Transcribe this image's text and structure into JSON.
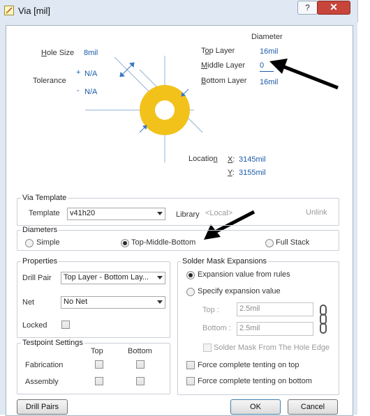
{
  "window": {
    "title": "Via [mil]",
    "help_label": "?",
    "close_label": "✕"
  },
  "diagram": {
    "diameter_heading": "Diameter",
    "hole_size_label": "Hole Size",
    "hole_size_value": "8mil",
    "tolerance_label": "Tolerance",
    "tol_plus_sign": "+",
    "tol_plus_value": "N/A",
    "tol_minus_sign": "-",
    "tol_minus_value": "N/A",
    "top_layer_label": "Top Layer",
    "top_layer_value": "16mil",
    "middle_layer_label": "Middle Layer",
    "middle_layer_value": "0",
    "bottom_layer_label": "Bottom Layer",
    "bottom_layer_value": "16mil",
    "location_label": "Location",
    "x_label": "X:",
    "x_value": "3145mil",
    "y_label": "Y:",
    "y_value": "3155mil",
    "via_color": "#f2c21b"
  },
  "via_template": {
    "group_title": "Via Template",
    "template_label": "Template",
    "template_value": "v41h20",
    "library_label": "Library",
    "library_value": "<Local>",
    "unlink_label": "Unlink"
  },
  "diameters": {
    "group_title": "Diameters",
    "options": [
      "Simple",
      "Top-Middle-Bottom",
      "Full Stack"
    ],
    "selected": "Top-Middle-Bottom"
  },
  "properties": {
    "group_title": "Properties",
    "drill_pair_label": "Drill Pair",
    "drill_pair_value": "Top Layer - Bottom Lay...",
    "net_label": "Net",
    "net_value": "No Net",
    "locked_label": "Locked"
  },
  "testpoint": {
    "group_title": "Testpoint Settings",
    "col_top": "Top",
    "col_bottom": "Bottom",
    "row_fabrication": "Fabrication",
    "row_assembly": "Assembly"
  },
  "solder_mask": {
    "group_title": "Solder Mask Expansions",
    "option_rules": "Expansion value from rules",
    "option_specify": "Specify expansion value",
    "top_label": "Top :",
    "top_value": "2.5mil",
    "bottom_label": "Bottom :",
    "bottom_value": "2.5mil",
    "from_hole_edge": "Solder Mask From The Hole Edge",
    "tent_top": "Force complete tenting on top",
    "tent_bottom": "Force complete tenting on bottom"
  },
  "footer": {
    "drill_pairs_label": "Drill Pairs",
    "ok_label": "OK",
    "cancel_label": "Cancel"
  }
}
